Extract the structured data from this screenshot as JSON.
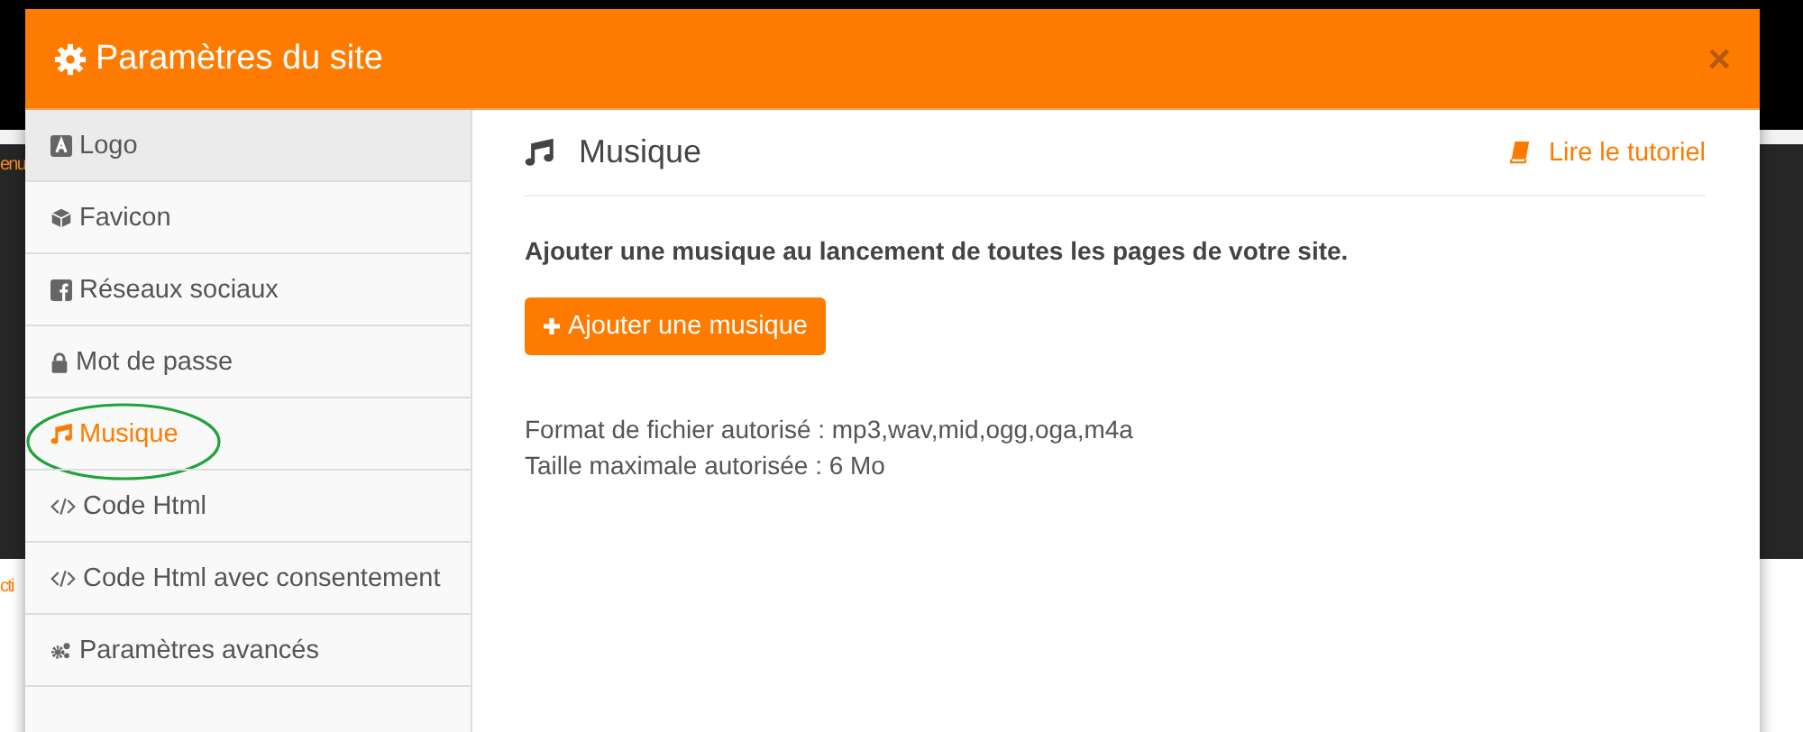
{
  "background": {
    "texts": [
      "enu",
      "cti"
    ]
  },
  "dialog": {
    "title": "Paramètres du site",
    "close": "×"
  },
  "sidebar": {
    "items": [
      {
        "label": "Logo",
        "kind": "logo",
        "selected": false,
        "hovered": true
      },
      {
        "label": "Favicon",
        "kind": "cube",
        "selected": false,
        "hovered": false
      },
      {
        "label": "Réseaux sociaux",
        "kind": "facebook",
        "selected": false,
        "hovered": false
      },
      {
        "label": "Mot de passe",
        "kind": "lock",
        "selected": false,
        "hovered": false
      },
      {
        "label": "Musique",
        "kind": "music",
        "selected": true,
        "hovered": false
      },
      {
        "label": "Code Html",
        "kind": "code",
        "selected": false,
        "hovered": false
      },
      {
        "label": "Code Html avec consentement",
        "kind": "code",
        "selected": false,
        "hovered": false
      },
      {
        "label": "Paramètres avancés",
        "kind": "gears",
        "selected": false,
        "hovered": false
      }
    ]
  },
  "content": {
    "heading": "Musique",
    "tutorial_link": "Lire le tutoriel",
    "description": "Ajouter une musique au lancement de toutes les pages de votre site.",
    "button": "Ajouter une musique",
    "info": [
      "Format de fichier autorisé : mp3,wav,mid,ogg,oga,m4a",
      "Taille maximale autorisée : 6 Mo"
    ]
  },
  "annotation": {
    "kind": "ellipse",
    "color": "#1fa33a"
  }
}
